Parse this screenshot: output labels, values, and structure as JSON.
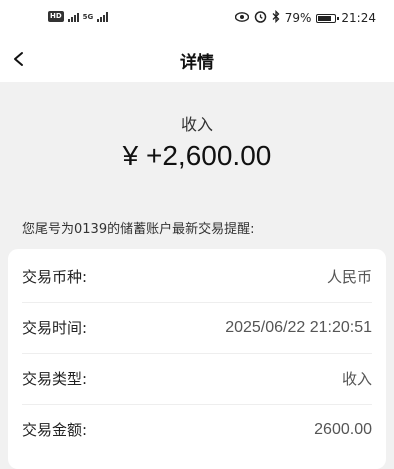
{
  "status_bar": {
    "left_badge": "HD",
    "net_label": "5G",
    "battery": "79%",
    "time": "21:24"
  },
  "header": {
    "title": "详情"
  },
  "summary": {
    "type": "收入",
    "amount": "¥ +2,600.00"
  },
  "notice": "您尾号为0139的储蓄账户最新交易提醒:",
  "details": [
    {
      "label": "交易币种:",
      "value": "人民币"
    },
    {
      "label": "交易时间:",
      "value": "2025/06/22 21:20:51"
    },
    {
      "label": "交易类型:",
      "value": "收入"
    },
    {
      "label": "交易金额:",
      "value": "2600.00"
    }
  ]
}
